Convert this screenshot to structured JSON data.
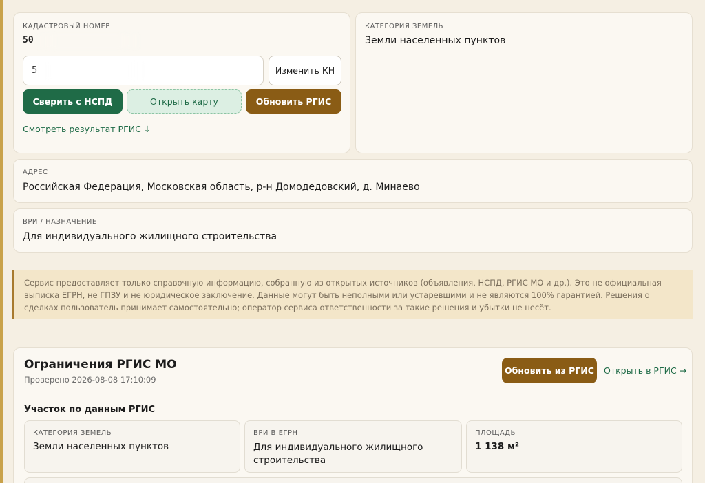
{
  "cadastral": {
    "label": "КАДАСТРОВЫЙ НОМЕР",
    "value": "50",
    "input_value": "5",
    "change_button": "Изменить КН",
    "verify_button": "Сверить с НСПД",
    "open_map_button": "Открыть карту",
    "update_rgis_button": "Обновить РГИС",
    "view_result_link": "Смотреть результат РГИС ↓"
  },
  "land_category": {
    "label": "КАТЕГОРИЯ ЗЕМЕЛЬ",
    "value": "Земли населенных пунктов"
  },
  "address": {
    "label": "АДРЕС",
    "value": "Российская Федерация, Московская область, р-н Домодедовский, д. Минаево"
  },
  "vri": {
    "label": "ВРИ / НАЗНАЧЕНИЕ",
    "value": "Для индивидуального жилищного строительства"
  },
  "notice": {
    "text": "Сервис предоставляет только справочную информацию, собранную из открытых источников (объявления, НСПД, РГИС МО и др.). Это не официальная выписка ЕГРН, не ГПЗУ и не юридическое заключение. Данные могут быть неполными или устаревшими и не являются 100% гарантией. Решения о сделках пользователь принимает самостоятельно; оператор сервиса ответственности за такие решения и убытки не несёт."
  },
  "rgis": {
    "title": "Ограничения РГИС МО",
    "checked": "Проверено 2026-08-08 17:10:09",
    "update_button": "Обновить из РГИС",
    "open_link": "Открыть в РГИС →",
    "section_title": "Участок по данным РГИС",
    "cells": [
      {
        "label": "КАТЕГОРИЯ ЗЕМЕЛЬ",
        "value": "Земли населенных пунктов"
      },
      {
        "label": "ВРИ В ЕГРН",
        "value": "Для индивидуального жилищного строительства"
      },
      {
        "label": "ПЛОЩАДЬ",
        "value": "1 138 м²"
      }
    ]
  },
  "colors": {
    "accent_green": "#1f6b47",
    "accent_brown": "#8a5c15",
    "notice_bg": "#f3e6c9"
  }
}
